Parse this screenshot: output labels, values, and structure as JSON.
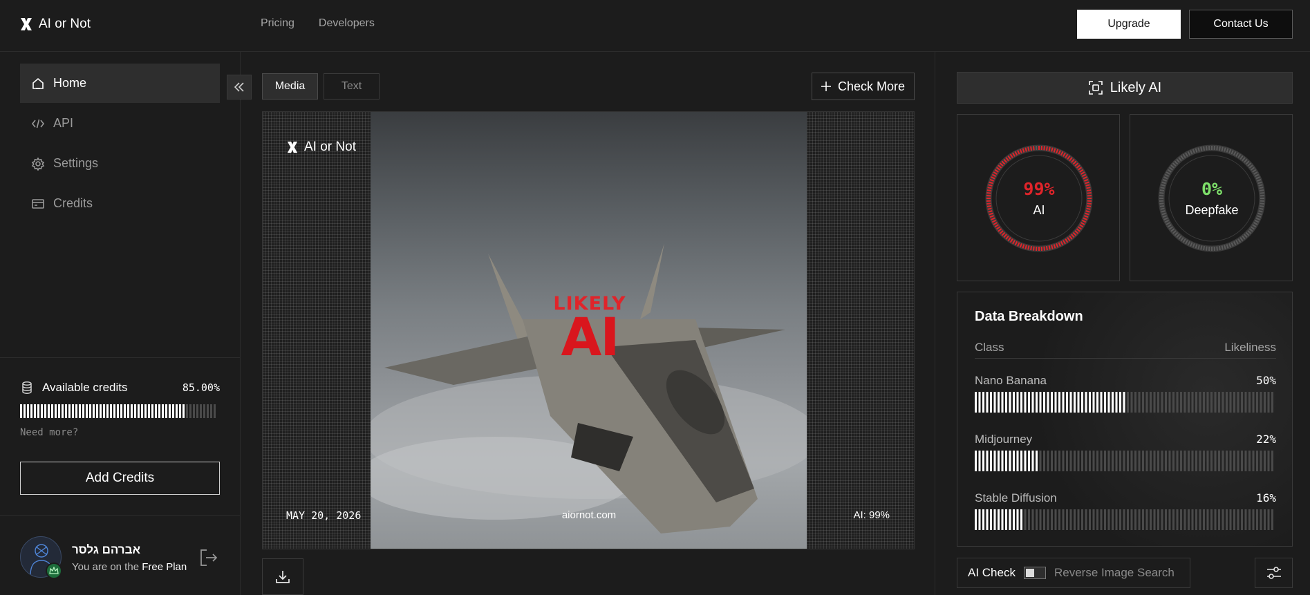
{
  "app": {
    "brand_name": "AI or Not"
  },
  "topnav": {
    "pricing": "Pricing",
    "developers": "Developers",
    "upgrade": "Upgrade",
    "contact": "Contact Us"
  },
  "sidebar": {
    "items": [
      {
        "label": "Home",
        "icon": "home-icon",
        "active": true
      },
      {
        "label": "API",
        "icon": "code-icon",
        "active": false
      },
      {
        "label": "Settings",
        "icon": "gear-icon",
        "active": false
      },
      {
        "label": "Credits",
        "icon": "card-icon",
        "active": false
      }
    ],
    "credits": {
      "label": "Available credits",
      "value": "85.00%",
      "fraction": 0.85,
      "need_more": "Need more?",
      "add_button": "Add Credits"
    },
    "user": {
      "name": "אברהם גלסר",
      "plan_prefix": "You are on the",
      "plan_name": "Free Plan"
    }
  },
  "main": {
    "tabs": [
      {
        "label": "Media",
        "active": true
      },
      {
        "label": "Text",
        "active": false
      }
    ],
    "check_more": "Check More",
    "image": {
      "brand": "AI or Not",
      "date": "MAY 20, 2026",
      "site": "aiornot.com",
      "score": "AI: 99%",
      "stamp_top": "LIKELY",
      "stamp_big": "AI"
    }
  },
  "result": {
    "verdict": "Likely AI",
    "ai_score": {
      "pct": "99%",
      "label": "AI",
      "fraction": 0.99,
      "color": "#e0242a"
    },
    "deepfake_score": {
      "pct": "0%",
      "label": "Deepfake",
      "fraction": 0.0,
      "color": "#7ee06a"
    },
    "breakdown": {
      "title": "Data Breakdown",
      "col_class": "Class",
      "col_likeliness": "Likeliness",
      "rows": [
        {
          "name": "Nano Banana",
          "value": "50%",
          "fraction": 0.5
        },
        {
          "name": "Midjourney",
          "value": "22%",
          "fraction": 0.22
        },
        {
          "name": "Stable Diffusion",
          "value": "16%",
          "fraction": 0.16
        }
      ]
    },
    "toggle": {
      "ai_check": "AI Check",
      "reverse_search": "Reverse Image Search"
    }
  }
}
